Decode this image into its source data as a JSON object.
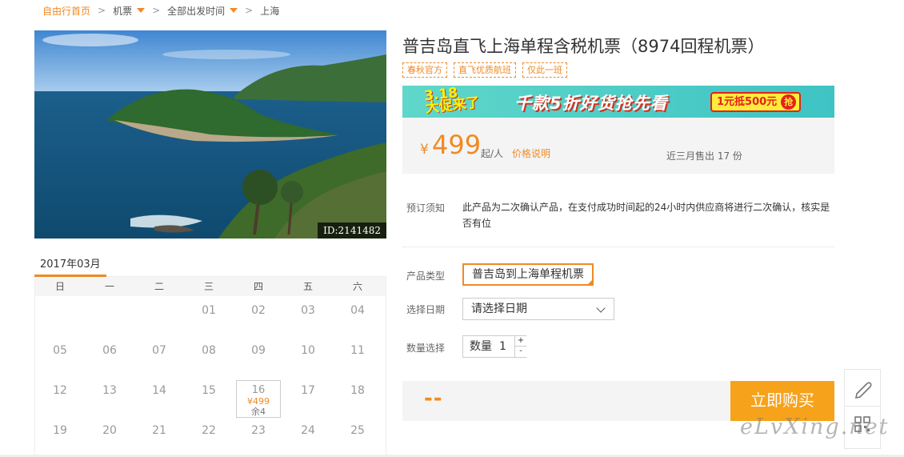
{
  "breadcrumb": {
    "home": "自由行首页",
    "flights": "机票",
    "departure": "全部出发时间",
    "city": "上海"
  },
  "photo": {
    "id_label": "ID:2141482"
  },
  "calendar": {
    "month": "2017年03月",
    "weekdays": [
      "日",
      "一",
      "二",
      "三",
      "四",
      "五",
      "六"
    ],
    "weeks": [
      [
        "",
        "",
        "",
        "01",
        "02",
        "03",
        "04"
      ],
      [
        "05",
        "06",
        "07",
        "08",
        "09",
        "10",
        "11"
      ],
      [
        "12",
        "13",
        "14",
        "15",
        "16",
        "17",
        "18"
      ],
      [
        "19",
        "20",
        "21",
        "22",
        "23",
        "24",
        "25"
      ]
    ],
    "available": {
      "day": "16",
      "price": "¥499",
      "remaining": "余4"
    }
  },
  "product": {
    "title": "普吉岛直飞上海单程含税机票（8974回程机票）",
    "tags": [
      "春秋官方",
      "直飞优质航班",
      "仅此一班"
    ]
  },
  "banner": {
    "date": "3.18",
    "headline": "大促来了",
    "slogan": "千款5折好货抢先看",
    "coupon": "1元抵500元",
    "grab": "抢"
  },
  "price": {
    "currency": "¥",
    "amount": "499",
    "unit": "起/人",
    "explain": "价格说明",
    "sold": "近三月售出 17 份"
  },
  "booking": {
    "notice_label": "预订须知",
    "notice_text": "此产品为二次确认产品，在支付成功时间起的24小时内供应商将进行二次确认，核实是否有位",
    "type_label": "产品类型",
    "type_value": "普吉岛到上海单程机票",
    "date_label": "选择日期",
    "date_value": "请选择日期",
    "qty_label": "数量选择",
    "qty_prefix": "数量",
    "qty_value": "1",
    "qty_plus": "+",
    "qty_minus": "-"
  },
  "buy": {
    "total": "--",
    "button": "立即购买"
  },
  "watermark": "eLvXing.net",
  "colors": {
    "accent": "#f08a24",
    "buy_button": "#f7a21b"
  }
}
